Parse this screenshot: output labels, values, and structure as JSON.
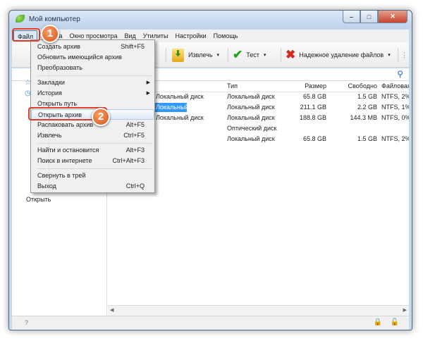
{
  "window": {
    "title": "Мой компьютер"
  },
  "menubar": {
    "items": [
      "Файл",
      "Правка",
      "Окно просмотра",
      "Вид",
      "Утилиты",
      "Настройки",
      "Помощь"
    ]
  },
  "toolbar": {
    "extract": "Извлечь",
    "test": "Тест",
    "secure_delete": "Надежное удаление файлов"
  },
  "file_menu": {
    "items": [
      {
        "label": "Создать архив",
        "shortcut": "Shift+F5"
      },
      {
        "label": "Обновить имеющийся архив",
        "shortcut": ""
      },
      {
        "label": "Преобразовать",
        "shortcut": ""
      },
      {
        "label": "Закладки",
        "shortcut": "",
        "submenu": true
      },
      {
        "label": "История",
        "shortcut": "",
        "submenu": true
      },
      {
        "label": "Открыть путь",
        "shortcut": ""
      },
      {
        "label": "Открыть архив",
        "shortcut": ""
      },
      {
        "label": "Распаковать архив",
        "shortcut": "Alt+F5"
      },
      {
        "label": "Извлечь",
        "shortcut": "Ctrl+F5"
      },
      {
        "label": "Найти и остановится",
        "shortcut": "Alt+F3"
      },
      {
        "label": "Поиск в интернете",
        "shortcut": "Ctrl+Alt+F3"
      },
      {
        "label": "Свернуть в трей",
        "shortcut": ""
      },
      {
        "label": "Выход",
        "shortcut": "Ctrl+Q"
      }
    ]
  },
  "columns": {
    "type": "Тип",
    "size": "Размер",
    "free": "Свободно",
    "fs": "Файловая"
  },
  "drives": [
    {
      "name": "Локальный диск",
      "type": "Локальный диск",
      "size": "65.8 GB",
      "free": "1.5 GB",
      "fs": "NTFS, 2%"
    },
    {
      "name": "Локальный диск",
      "type": "Локальный диск",
      "size": "211.1 GB",
      "free": "2.2 GB",
      "fs": "NTFS, 1%"
    },
    {
      "name": "Локальный диск",
      "type": "Локальный диск",
      "size": "188.8 GB",
      "free": "144.3 MB",
      "fs": "NTFS, 0%"
    },
    {
      "name": "",
      "type": "Оптический диск",
      "size": "",
      "free": "",
      "fs": ""
    },
    {
      "name": "",
      "type": "Локальный диск",
      "size": "65.8 GB",
      "free": "1.5 GB",
      "fs": "NTFS, 2%"
    }
  ],
  "tree": {
    "open_item": "Открыть"
  },
  "status": {
    "help": "?"
  },
  "callouts": {
    "first": "1",
    "second": "2"
  }
}
